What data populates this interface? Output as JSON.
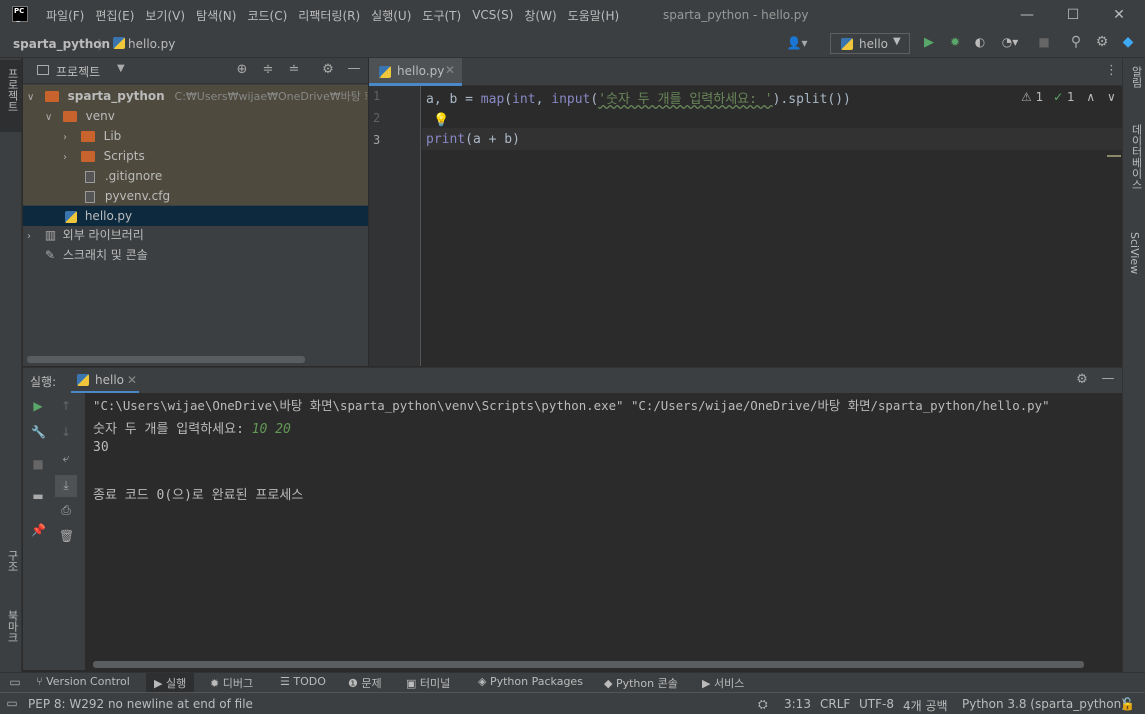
{
  "menu": [
    "파일(F)",
    "편집(E)",
    "보기(V)",
    "탐색(N)",
    "코드(C)",
    "리팩터링(R)",
    "실행(U)",
    "도구(T)",
    "VCS(S)",
    "창(W)",
    "도움말(H)"
  ],
  "window_title": "sparta_python - hello.py",
  "breadcrumb": {
    "project": "sparta_python",
    "file": "hello.py"
  },
  "run_config": "hello",
  "project_panel": {
    "title": "프로젝트",
    "root": "sparta_python",
    "root_path": "C:₩Users₩wijae₩OneDrive₩바탕 화면₩s",
    "items": [
      "venv",
      "Lib",
      "Scripts",
      ".gitignore",
      "pyvenv.cfg",
      "hello.py",
      "외부 라이브러리",
      "스크래치 및 콘솔"
    ]
  },
  "editor": {
    "tab": "hello.py",
    "line_numbers": [
      "1",
      "2",
      "3"
    ],
    "warnings": "1",
    "ok": "1",
    "line1": {
      "a": "a, b = ",
      "map": "map",
      "p1": "(",
      "int": "int",
      "c": ", ",
      "input": "input",
      "p2": "(",
      "str": "'숫자 두 개를 입력하세요: '",
      "rest": ").split())"
    },
    "line3": {
      "print": "print",
      "p": "(a + b)"
    }
  },
  "run": {
    "label": "실행:",
    "tab": "hello",
    "cmd": "\"C:\\Users\\wijae\\OneDrive\\바탕 화면\\sparta_python\\venv\\Scripts\\python.exe\" \"C:/Users/wijae/OneDrive/바탕 화면/sparta_python/hello.py\"",
    "prompt": "숫자 두 개를 입력하세요: ",
    "input": "10 20",
    "result": "30",
    "exit": "종료 코드 0(으)로 완료된 프로세스"
  },
  "left_strip": [
    "프로젝트",
    "구조",
    "북마크"
  ],
  "right_strip": [
    "알림",
    "데이터베이스",
    "SciView"
  ],
  "bottom_tabs": [
    "Version Control",
    "실행",
    "디버그",
    "TODO",
    "문제",
    "터미널",
    "Python Packages",
    "Python 콘솔",
    "서비스"
  ],
  "status": {
    "message": "PEP 8: W292 no newline at end of file",
    "position": "3:13",
    "line_sep": "CRLF",
    "encoding": "UTF-8",
    "indent": "4개 공백",
    "interpreter": "Python 3.8 (sparta_python)"
  },
  "colors": {
    "keyword": "#cc7832",
    "builtin": "#8888c6",
    "string": "#6a8759",
    "input": "#629755",
    "accent": "#4a88c7"
  }
}
